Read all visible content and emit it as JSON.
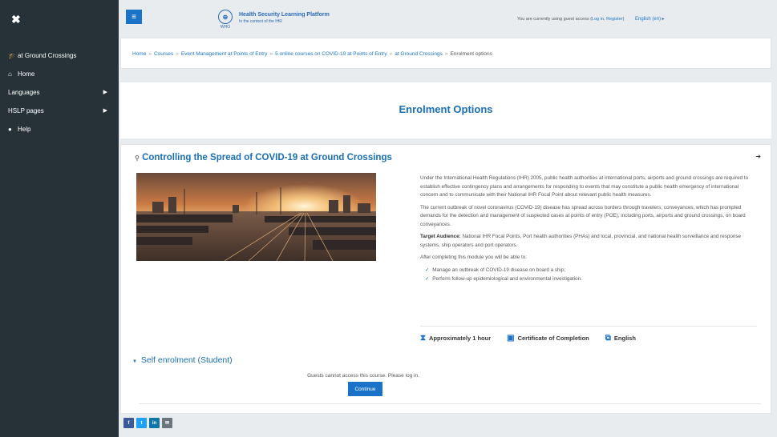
{
  "sidebar": {
    "close_icon": "close-icon",
    "items": [
      {
        "label": "at Ground Crossings",
        "icon": "graduation-cap-icon",
        "has_caret": false
      },
      {
        "label": "Home",
        "icon": "home-icon",
        "has_caret": false
      },
      {
        "label": "Languages",
        "icon": "",
        "has_caret": true
      },
      {
        "label": "HSLP pages",
        "icon": "",
        "has_caret": true
      },
      {
        "label": "Help",
        "icon": "help-icon",
        "has_caret": false
      }
    ]
  },
  "header": {
    "platform_title": "Health Security Learning Platform",
    "platform_sub": "In the context of the IHR",
    "who_label": "WHO",
    "guest_prefix": "You are currently using guest access (",
    "login_link": "Log in",
    "register_link": "Register",
    "guest_suffix": ")",
    "language": "English (en) ▸"
  },
  "breadcrumb": {
    "items": [
      "Home",
      "Courses",
      "Event Management at Points of Entry",
      "5 online courses on COVID-19 at Points of Entry",
      "at Ground Crossings"
    ],
    "current": "Enrolment options"
  },
  "page": {
    "title": "Enrolment Options"
  },
  "course": {
    "title": "Controlling the Spread of COVID-19 at Ground Crossings",
    "paragraph1": "Under the International Health Regulations (IHR) 2005, public health authorities at international ports, airports and ground crossings are required to establish effective contingency plans and arrangements for responding to events that may constitute a public health emergency of international concern and to communicate with their National IHR Focal Point about relevant public health measures.",
    "paragraph2": "The current outbreak of novel coronavirus (COVID-19) disease has spread across borders through travelers, conveyances, which has prompted demands for the detection and management of suspected cases at points of entry (POE), including ports, airports and ground crossings, on board conveyances.",
    "audience_label": "Target Audience:",
    "audience_text": " National IHR Focal Points, Port health authorities (PHAs) and local, provincial, and national health surveillance and response systems, ship operators and port operators.",
    "after_text": "After completing this module you will be able to:",
    "outcomes": [
      "Manage an outbreak of COVID-19 disease on board a ship;",
      "Perform follow-up epidemiological and environmental investigation."
    ],
    "duration": "Approximately 1 hour",
    "certificate": "Certificate of Completion",
    "language": "English"
  },
  "enrolment": {
    "heading": "Self enrolment (Student)",
    "message": "Guests cannot access this course. Please log in.",
    "button": "Continue"
  },
  "social": [
    {
      "label": "f",
      "color": "#3b5998",
      "icon": "facebook-icon"
    },
    {
      "label": "t",
      "color": "#1da1f2",
      "icon": "twitter-icon"
    },
    {
      "label": "in",
      "color": "#0e76a8",
      "icon": "linkedin-icon"
    },
    {
      "label": "✉",
      "color": "#6c757d",
      "icon": "email-icon"
    }
  ],
  "colors": {
    "sidebar_bg": "#263238",
    "accent": "#1a73c9",
    "title_blue": "#1a6fb5"
  }
}
